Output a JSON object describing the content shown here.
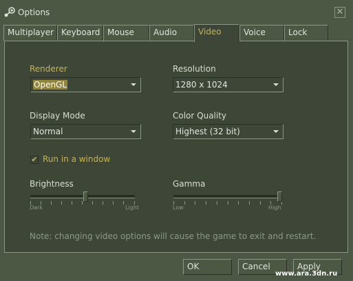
{
  "window": {
    "title": "Options",
    "close_icon": "close-icon",
    "app_icon": "steam-logo-icon"
  },
  "tabs": [
    {
      "label": "Multiplayer",
      "active": false
    },
    {
      "label": "Keyboard",
      "active": false
    },
    {
      "label": "Mouse",
      "active": false
    },
    {
      "label": "Audio",
      "active": false
    },
    {
      "label": "Video",
      "active": true
    },
    {
      "label": "Voice",
      "active": false
    },
    {
      "label": "Lock",
      "active": false
    }
  ],
  "video": {
    "renderer": {
      "label": "Renderer",
      "value": "OpenGL"
    },
    "resolution": {
      "label": "Resolution",
      "value": "1280 x 1024"
    },
    "display_mode": {
      "label": "Display Mode",
      "value": "Normal"
    },
    "color_quality": {
      "label": "Color Quality",
      "value": "Highest (32 bit)"
    },
    "run_in_window": {
      "label": "Run in a window",
      "checked": true
    },
    "brightness": {
      "label": "Brightness",
      "min_label": "Dark",
      "max_label": "Light",
      "level": 0.53
    },
    "gamma": {
      "label": "Gamma",
      "min_label": "Low",
      "max_label": "High",
      "level": 1.0
    },
    "note": "Note: changing video options will cause the game to exit and restart."
  },
  "buttons": {
    "ok": "OK",
    "cancel": "Cancel",
    "apply": "Apply"
  },
  "watermark": "www.ara.3dn.ru",
  "colors": {
    "accent": "#c4b550",
    "panel": "#3e4637",
    "chrome": "#4c5844"
  }
}
